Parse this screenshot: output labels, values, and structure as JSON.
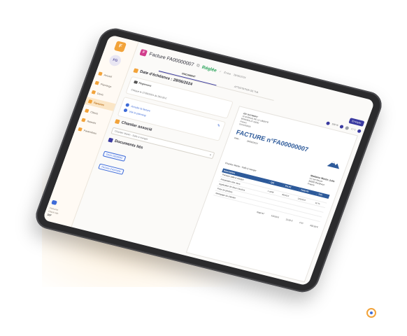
{
  "app": {
    "logo_letter": "F",
    "user_initials": "FG"
  },
  "sidebar": {
    "items": [
      {
        "label": "Accueil",
        "active": false
      },
      {
        "label": "Plannings",
        "active": false
      },
      {
        "label": "Devis",
        "active": false
      },
      {
        "label": "Factures",
        "active": true
      },
      {
        "label": "Clients",
        "active": false
      },
      {
        "label": "Relevés",
        "active": false
      },
      {
        "label": "Paramètres",
        "active": false
      }
    ],
    "footer_line1": "Factures",
    "footer_line2": "Client Info",
    "footer_brand": "ZEF"
  },
  "header": {
    "title": "Facture FA00000007",
    "status": "Réglée",
    "meta1": "Émise",
    "meta2": "28/06/2024"
  },
  "tabs": [
    {
      "label": "DOCUMENT",
      "active": true
    },
    {
      "label": "ATTESTATION DE TVA",
      "active": false
    }
  ],
  "left": {
    "echeance": "Date d'échéance : 28/06/2024",
    "reglement_label": "Règlement",
    "reglement_value": "Chèque le 27/06/2024 de 283,00 €",
    "annuler": "Annuler la facture",
    "archiver": "Voir le planning",
    "chantier_title": "Chantier associé",
    "chantier_value": "Chantier Martin - Salle à manger",
    "docs_title": "Documents liés",
    "doc1": "Devis DE00003",
    "doc2": "Facture d'acompte"
  },
  "viewer": {
    "download": "Envoyer",
    "zoom": "100 %",
    "page": "1 / 1",
    "company_lines": [
      "ZEF BATIMENT",
      "10 AVENUE DE LA LIBERTE",
      "BORDEAUX 33000",
      "France",
      "0102030405"
    ],
    "invoice_title": "FACTURE n°FA00000007",
    "date_label": "Date :",
    "date_value": "28/06/2024",
    "client_line": "Chantier Martin - Salle à manger",
    "client_name": "Madame Martin Julie",
    "client_addr1": "12 rue Neuve",
    "client_addr2": "33000 Bordeaux",
    "client_addr3": "France",
    "columns": [
      "Description",
      "Qté",
      "PU HT",
      "Total HT",
      "TVA"
    ],
    "rows": [
      [
        "Peinture salle à manger",
        "",
        "",
        "",
        ""
      ],
      [
        "Préparation des murs",
        "1 unité",
        "80,00 €",
        "120,00 €",
        "10 %"
      ],
      [
        "Application de deux couches",
        "",
        "",
        "",
        ""
      ],
      [
        "Pose de plinthes",
        "",
        "",
        "",
        ""
      ],
      [
        "Nettoyage du chantier",
        "",
        "",
        "",
        ""
      ]
    ],
    "total_ht_label": "Total HT",
    "total_ht_value": "120,00 €",
    "tva_value": "12,00 €",
    "ttc_label": "TTC",
    "ttc_value": "283,00 €"
  },
  "colors": {
    "accent": "#f2a33a",
    "primary": "#3a3aa0",
    "success": "#2aa35a",
    "invoice_blue": "#2d5a9a"
  }
}
